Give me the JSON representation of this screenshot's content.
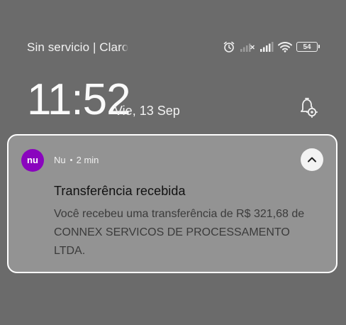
{
  "status_bar": {
    "carrier_main": "Sin servicio | Cla",
    "carrier_faded": "ro",
    "battery_level": "54",
    "icons": [
      "alarm-icon",
      "signal-off-icon",
      "signal-icon",
      "wifi-icon",
      "battery-icon"
    ]
  },
  "lockscreen": {
    "time": "11:52",
    "date": "Vie, 13 Sep",
    "settings_icon": "notification-settings-icon"
  },
  "notification": {
    "app_name": "Nu",
    "time_ago": "2 min",
    "app_icon_text": "nu",
    "title": "Transferência recebida",
    "body": "Você recebeu uma transferência de R$ 321,68 de CONNEX SERVICOS DE PROCESSAMENTO LTDA.",
    "colors": {
      "app_icon_bg": "#8a05be",
      "card_bg": "#939393",
      "card_border": "#ffffff"
    }
  }
}
